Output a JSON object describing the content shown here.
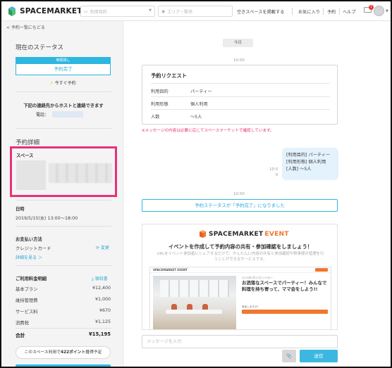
{
  "header": {
    "logo_text": "SPACEMARKET",
    "purpose_placeholder": "利用目的",
    "area_placeholder": "エリア・駅名",
    "nav": {
      "host": "空きスペースを掲載する",
      "favorites": "お気に入り",
      "reservations": "予約",
      "help": "ヘルプ"
    },
    "mail_count": "1"
  },
  "sidebar": {
    "back": "< 予約一覧にもどる",
    "status_title": "現在のステータス",
    "status_top": "時間貸し",
    "status_value": "予約完了",
    "now_text": "今すぐ予約",
    "contact_text": "下記の連絡先からホストと連絡できます",
    "phone_label": "電話：",
    "details_title": "予約詳細",
    "space_label": "スペース",
    "datetime_label": "日時",
    "datetime_value": "2019/5/15(水) 13:00〜18:00",
    "payment_label": "お支払い方法",
    "payment_value": "クレジットカード",
    "change_link": "変更",
    "detail_link": "詳細を見る ＞",
    "fees_title": "ご利用料金明細",
    "receipt_link": "領収書",
    "fees": [
      {
        "name": "基本プラン",
        "amount": "¥12,400"
      },
      {
        "name": "維持管理費",
        "amount": "¥1,000"
      },
      {
        "name": "サービス料",
        "amount": "¥670"
      },
      {
        "name": "消費税",
        "amount": "¥1,125"
      }
    ],
    "total_label": "合計",
    "total_amount": "¥15,195",
    "points_pre": "このスペース利用で",
    "points_value": "422ポイント",
    "points_post": "獲得予定"
  },
  "chat": {
    "today": "今日",
    "time1": "10:50",
    "request": {
      "title": "予約リクエスト",
      "rows": [
        {
          "key": "利用目的",
          "value": "パーティー"
        },
        {
          "key": "利用形態",
          "value": "個人利用"
        },
        {
          "key": "人数",
          "value": "〜5人"
        }
      ]
    },
    "notice": "※メッセージの内容は必要に応じてスペースマーケットで確認しています。",
    "bubble_lines": [
      "[利用目的] パーティー",
      "[利用形態] 個人利用",
      "[人数] 〜5人"
    ],
    "bubble_time": "10:5",
    "bubble_read": "0",
    "time2": "10:50",
    "status_banner": "予約ステータスが「予約完了」になりました",
    "promo": {
      "logo_a": "SPACEMARKET",
      "logo_b": "EVENT",
      "headline": "イベントを作成して予約内容の共有・参加確認をしましょう！",
      "desc": "URLをイベント参加者にシェアするだけで、かんたんに内容の共有と参加確認や幹事様の管理を行うことができるサービスです。",
      "mock_logo": "SPACEMARKET EVENT",
      "mock_title": "お洒落なスペースでパーティー！みんなで料理を持ち寄って、ママ会をしよう!!",
      "mock_meta": "2019年5月15日 13:00〜",
      "mock_mini": "参加しますか？"
    },
    "input_placeholder": "メッセージを入力",
    "attach_icon": "📎",
    "send_label": "送信"
  },
  "colors": {
    "accent": "#2db6e0",
    "highlight": "#e8317a",
    "event_orange": "#f2762e"
  }
}
